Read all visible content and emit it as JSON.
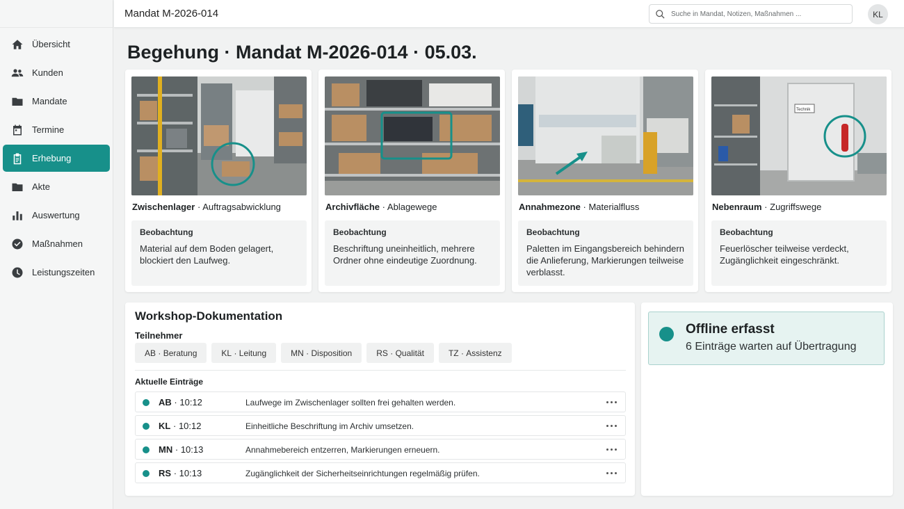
{
  "header": {
    "title": "Mandat M-2026-014",
    "search_placeholder": "Suche in Mandat, Notizen, Maßnahmen ...",
    "avatar_initials": "KL"
  },
  "sidebar": {
    "items": [
      {
        "label": "Übersicht",
        "icon": "home-icon",
        "active": false
      },
      {
        "label": "Kunden",
        "icon": "people-icon",
        "active": false
      },
      {
        "label": "Mandate",
        "icon": "folder-icon",
        "active": false
      },
      {
        "label": "Termine",
        "icon": "calendar-icon",
        "active": false
      },
      {
        "label": "Erhebung",
        "icon": "clipboard-icon",
        "active": true
      },
      {
        "label": "Akte",
        "icon": "folder-icon",
        "active": false
      },
      {
        "label": "Auswertung",
        "icon": "bar-chart-icon",
        "active": false
      },
      {
        "label": "Maßnahmen",
        "icon": "check-circle-icon",
        "active": false
      },
      {
        "label": "Leistungszeiten",
        "icon": "clock-icon",
        "active": false
      }
    ]
  },
  "page": {
    "title": "Begehung · Mandat M-2026-014 · 05.03."
  },
  "cards": [
    {
      "area": "Zwischenlager",
      "topic": "Auftragsabwicklung",
      "obs_label": "Beobachtung",
      "obs_text": "Material auf dem Boden gelagert, blockiert den Laufweg.",
      "marker": "circle"
    },
    {
      "area": "Archivfläche",
      "topic": "Ablagewege",
      "obs_label": "Beobachtung",
      "obs_text": "Beschriftung uneinheitlich, mehrere Ordner ohne eindeutige Zuordnung.",
      "marker": "rectangle"
    },
    {
      "area": "Annahmezone",
      "topic": "Materialfluss",
      "obs_label": "Beobachtung",
      "obs_text": "Paletten im Eingangsbereich behindern die Anlieferung, Markierungen teilweise verblasst.",
      "marker": "arrow"
    },
    {
      "area": "Nebenraum",
      "topic": "Zugriffswege",
      "obs_label": "Beobachtung",
      "obs_text": "Feuerlöscher teilweise verdeckt, Zugänglichkeit eingeschränkt.",
      "marker": "circle",
      "door_sign": "Technik"
    }
  ],
  "separator": "·",
  "workshop": {
    "title": "Workshop-Dokumentation",
    "participants_label": "Teilnehmer",
    "participants": [
      {
        "code": "AB",
        "role": "Beratung"
      },
      {
        "code": "KL",
        "role": "Leitung"
      },
      {
        "code": "MN",
        "role": "Disposition"
      },
      {
        "code": "RS",
        "role": "Qualität"
      },
      {
        "code": "TZ",
        "role": "Assistenz"
      }
    ],
    "entries_label": "Aktuelle Einträge",
    "entries": [
      {
        "who": "AB",
        "time": "10:12",
        "text": "Laufwege im Zwischenlager sollten frei gehalten werden."
      },
      {
        "who": "KL",
        "time": "10:12",
        "text": "Einheitliche Beschriftung im Archiv umsetzen."
      },
      {
        "who": "MN",
        "time": "10:13",
        "text": "Annahmebereich entzerren, Markierungen erneuern."
      },
      {
        "who": "RS",
        "time": "10:13",
        "text": "Zugänglichkeit der Sicherheitseinrichtungen regelmäßig prüfen."
      }
    ]
  },
  "offline": {
    "title": "Offline erfasst",
    "subtitle": "6 Einträge warten auf Übertragung"
  },
  "colors": {
    "accent": "#17908a",
    "accent_light": "#e6f3f1"
  }
}
